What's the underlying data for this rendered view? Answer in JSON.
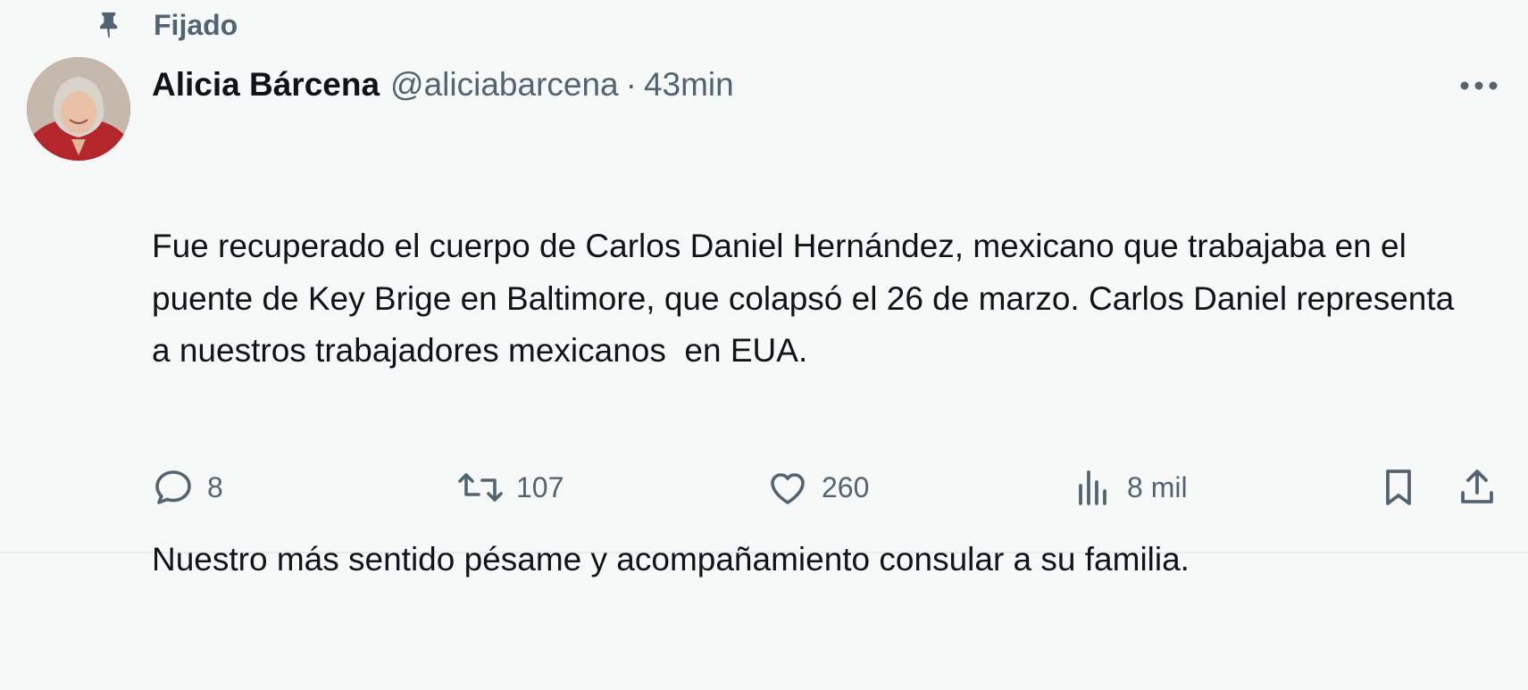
{
  "pinned": {
    "label": "Fijado",
    "icon": "pin-icon"
  },
  "tweet": {
    "author": {
      "name": "Alicia Bárcena",
      "handle": "@aliciabarcena"
    },
    "separator": "·",
    "time": "43min",
    "text": {
      "paragraph1": "Fue recuperado el cuerpo de Carlos Daniel Hernández, mexicano que trabajaba en el puente de Key Brige en Baltimore, que colapsó el 26 de marzo. Carlos Daniel representa a nuestros trabajadores mexicanos  en EUA.",
      "paragraph2": "Nuestro más sentido pésame y acompañamiento consular a su familia."
    },
    "actions": {
      "replies": "8",
      "retweets": "107",
      "likes": "260",
      "views": "8 mil"
    }
  },
  "colors": {
    "background": "#f7f9f9",
    "text": "#0f1419",
    "secondary": "#536471",
    "avatar_jacket": "#b3262b"
  }
}
